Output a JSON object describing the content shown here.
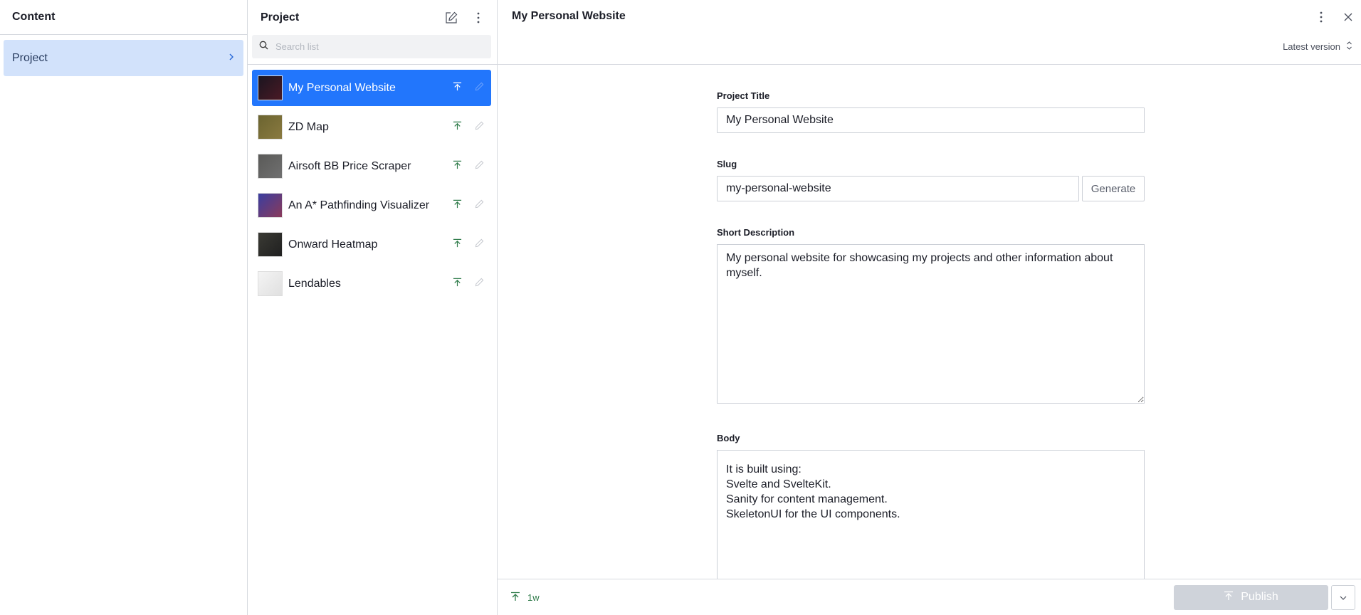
{
  "content_pane": {
    "title": "Content",
    "items": [
      {
        "label": "Project"
      }
    ]
  },
  "list_pane": {
    "title": "Project",
    "search_placeholder": "Search list",
    "items": [
      {
        "label": "My Personal Website",
        "selected": true,
        "thumb_colors": [
          "#1a1520",
          "#4a1a25"
        ]
      },
      {
        "label": "ZD Map",
        "selected": false,
        "thumb_colors": [
          "#6b6430",
          "#8a7a40"
        ]
      },
      {
        "label": "Airsoft BB Price Scraper",
        "selected": false,
        "thumb_colors": [
          "#5a5a58",
          "#707070"
        ]
      },
      {
        "label": "An A* Pathfinding Visualizer",
        "selected": false,
        "thumb_colors": [
          "#3a3ea0",
          "#8a3a5a"
        ]
      },
      {
        "label": "Onward Heatmap",
        "selected": false,
        "thumb_colors": [
          "#3a3a34",
          "#202020"
        ]
      },
      {
        "label": "Lendables",
        "selected": false,
        "thumb_colors": [
          "#f4f4f4",
          "#e0e0e0"
        ]
      }
    ]
  },
  "document": {
    "title": "My Personal Website",
    "version_label": "Latest version",
    "fields": {
      "project_title": {
        "label": "Project Title",
        "value": "My Personal Website"
      },
      "slug": {
        "label": "Slug",
        "value": "my-personal-website",
        "button": "Generate"
      },
      "short_description": {
        "label": "Short Description",
        "value": "My personal website for showcasing my projects and other information about myself."
      },
      "body": {
        "label": "Body",
        "lines": [
          "It is built using:",
          "Svelte and SvelteKit.",
          "Sanity for content management.",
          "SkeletonUI for the UI components."
        ]
      }
    },
    "footer": {
      "status": "1w",
      "publish_label": "Publish"
    }
  },
  "colors": {
    "accent": "#2276fc",
    "nav_selected": "#d2e2fb",
    "published": "#2f7b4a",
    "publish_disabled": "#cfd3da"
  }
}
